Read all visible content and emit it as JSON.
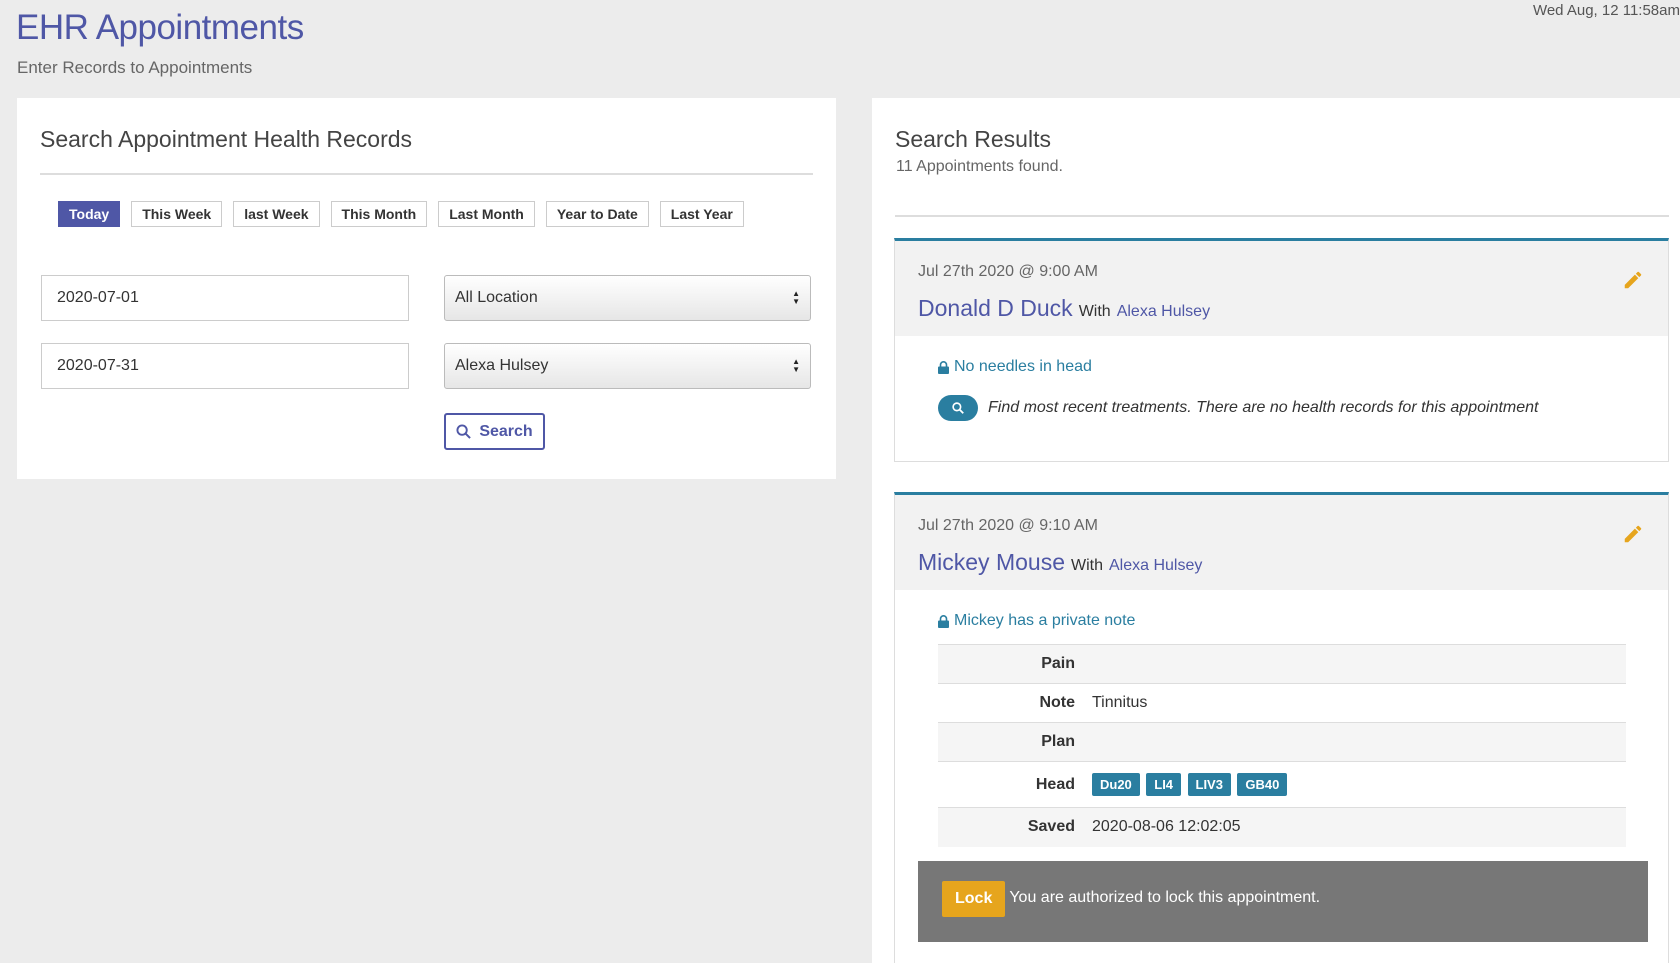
{
  "header": {
    "title": "EHR Appointments",
    "subtitle": "Enter Records to Appointments",
    "datetime": "Wed Aug, 12 11:58am"
  },
  "search_panel": {
    "title": "Search Appointment Health Records",
    "ranges": [
      "Today",
      "This Week",
      "last Week",
      "This Month",
      "Last Month",
      "Year to Date",
      "Last Year"
    ],
    "active_range": "Today",
    "start_date": "2020-07-01",
    "end_date": "2020-07-31",
    "location": "All Location",
    "practitioner": "Alexa Hulsey",
    "search_label": "Search"
  },
  "results": {
    "title": "Search Results",
    "count_text": "11 Appointments found.",
    "appointments": [
      {
        "date": "Jul 27th 2020 @ 9:00 AM",
        "patient": "Donald D Duck",
        "with_label": "With",
        "practitioner": "Alexa Hulsey",
        "private_note": "No needles in head",
        "find_text": "Find most recent treatments. There are no health records for this appointment"
      },
      {
        "date": "Jul 27th 2020 @ 9:10 AM",
        "patient": "Mickey Mouse",
        "with_label": "With",
        "practitioner": "Alexa Hulsey",
        "private_note": "Mickey has a private note",
        "record": {
          "pain_label": "Pain",
          "pain": "",
          "note_label": "Note",
          "note": "Tinnitus",
          "plan_label": "Plan",
          "plan": "",
          "head_label": "Head",
          "head_points": [
            "Du20",
            "LI4",
            "LIV3",
            "GB40"
          ],
          "saved_label": "Saved",
          "saved": "2020-08-06 12:02:05"
        },
        "lock_label": "Lock",
        "lock_message": "You are authorized to lock this appointment."
      }
    ]
  },
  "colors": {
    "brand": "#4f57a6",
    "accent": "#2a7ea0",
    "lock": "#e6a51d",
    "edit": "#e6a51d"
  },
  "icons": [
    "search-icon",
    "pencil-icon",
    "lock-icon",
    "select-arrows-icon"
  ]
}
